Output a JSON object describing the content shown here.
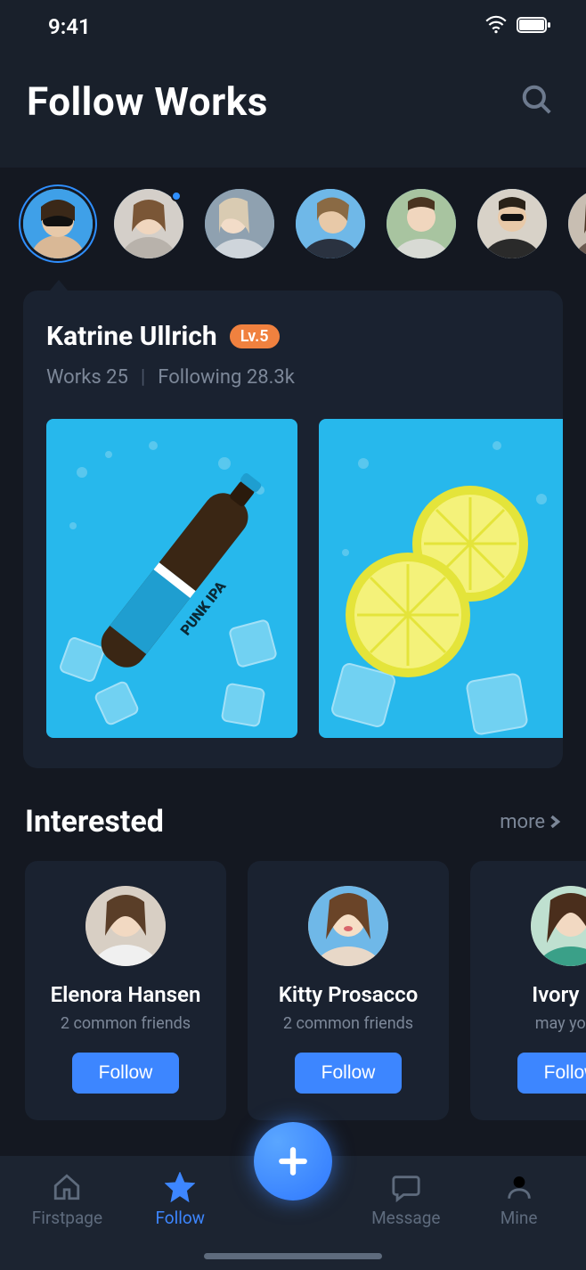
{
  "status": {
    "time": "9:41"
  },
  "header": {
    "title": "Follow Works"
  },
  "stories": [
    {
      "active": true,
      "dot": false
    },
    {
      "active": false,
      "dot": true
    },
    {
      "active": false,
      "dot": false
    },
    {
      "active": false,
      "dot": false
    },
    {
      "active": false,
      "dot": false
    },
    {
      "active": false,
      "dot": false
    },
    {
      "active": false,
      "dot": false
    }
  ],
  "featured": {
    "name": "Katrine Ullrich",
    "level": "Lv.5",
    "works_label": "Works 25",
    "following_label": "Following 28.3k"
  },
  "interested": {
    "title": "Interested",
    "more_label": "more",
    "cards": [
      {
        "name": "Elenora Hansen",
        "sub": "2 common friends",
        "btn": "Follow"
      },
      {
        "name": "Kitty Prosacco",
        "sub": "2 common friends",
        "btn": "Follow"
      },
      {
        "name": "Ivory Ku",
        "sub": "may you k",
        "btn": "Follow"
      }
    ]
  },
  "tabs": {
    "firstpage": "Firstpage",
    "follow": "Follow",
    "message": "Message",
    "mine": "Mine"
  }
}
